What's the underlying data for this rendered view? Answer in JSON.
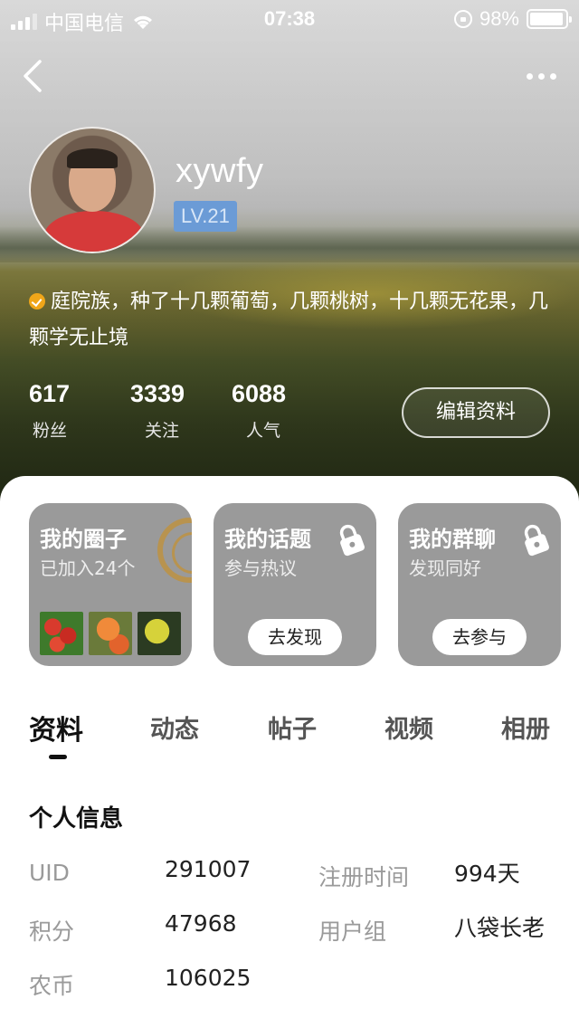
{
  "status_bar": {
    "carrier": "中国电信",
    "time": "07:38",
    "battery": "98%"
  },
  "profile": {
    "username": "xywfy",
    "level": "LV.21",
    "bio": "庭院族，种了十几颗葡萄，几颗桃树，十几颗无花果，几颗学无止境",
    "stats": [
      {
        "value": "617",
        "label": "粉丝"
      },
      {
        "value": "3339",
        "label": "关注"
      },
      {
        "value": "6088",
        "label": "人气"
      }
    ],
    "edit_label": "编辑资料"
  },
  "cards": {
    "circle": {
      "title": "我的圈子",
      "subtitle": "已加入24个"
    },
    "topic": {
      "title": "我的话题",
      "subtitle": "参与热议",
      "button": "去发现"
    },
    "group": {
      "title": "我的群聊",
      "subtitle": "发现同好",
      "button": "去参与"
    }
  },
  "tabs": [
    {
      "label": "资料",
      "active": true
    },
    {
      "label": "动态"
    },
    {
      "label": "帖子"
    },
    {
      "label": "视频"
    },
    {
      "label": "相册"
    }
  ],
  "info": {
    "section_title": "个人信息",
    "uid_label": "UID",
    "uid_value": "291007",
    "register_label": "注册时间",
    "register_value": "994天",
    "points_label": "积分",
    "points_value": "47968",
    "group_label": "用户组",
    "group_value": "八袋长老",
    "coins_label": "农币",
    "coins_value": "106025"
  },
  "icons": {
    "back": "chevron-left-icon",
    "more": "more-dots-icon",
    "lock": "lock-icon",
    "wifi": "wifi-icon",
    "battery": "battery-icon"
  },
  "colors": {
    "level_badge": "#6b9bd6",
    "card_bg": "#9a9a9a",
    "label_gray": "#9a9a9a",
    "verified_badge": "#f0a619"
  }
}
